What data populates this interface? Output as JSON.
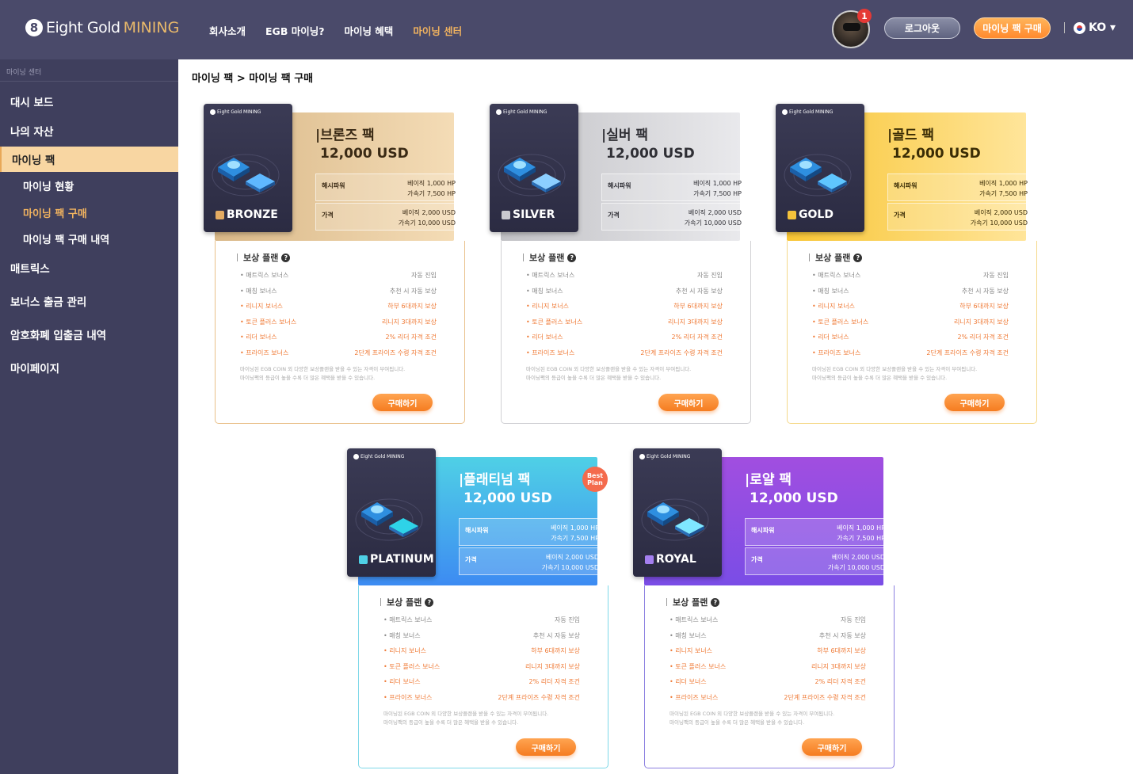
{
  "header": {
    "logo_main": "Eight Gold",
    "logo_accent": "MINING",
    "logo_badge": "8",
    "nav": [
      "회사소개",
      "EGB 마이닝?",
      "마이닝 혜택",
      "마이닝 센터"
    ],
    "notifications": "1",
    "logout_label": "로그아웃",
    "buy_label": "마이닝 팩 구매",
    "lang": "KO ▾"
  },
  "sidebar": {
    "section": "마이닝 센터",
    "items": [
      "대시 보드",
      "나의 자산",
      "마이닝 팩",
      "마이닝 현황",
      "마이닝 팩 구매",
      "마이닝 팩 구매 내역",
      "매트릭스",
      "보너스 출금 관리",
      "암호화폐 입출금 내역",
      "마이페이지"
    ]
  },
  "breadcrumb": "마이닝 팩 > 마이닝 팩 구매",
  "common": {
    "mini_logo": "Eight Gold MINING",
    "price": "12,000 USD",
    "hash_label": "해시파워",
    "hash_base": "베이직  1,000 HP",
    "hash_boost": "가속기  7,500 HP",
    "price_label": "가격",
    "price_base": "베이직  2,000 USD",
    "price_boost": "가속기  10,000 USD",
    "reward_title": "보상 플랜",
    "rewards": [
      {
        "name": "• 매트릭스 보너스",
        "value": "자동 진입"
      },
      {
        "name": "• 매칭 보너스",
        "value": "추천 시 자동 보상"
      },
      {
        "name": "• 리니지 보너스",
        "value": "하부 6대까지 보상"
      },
      {
        "name": "• 토큰 플러스 보너스",
        "value": "리니지 3대까지 보상"
      },
      {
        "name": "• 리더 보너스",
        "value": "2% 리더 자격 조건"
      },
      {
        "name": "• 프라이즈 보너스",
        "value": "2단계 프라이즈 수령 자격 조건"
      }
    ],
    "note1": "마이닝된 EGB COIN 외 다양한 보상플랜을 받을 수 있는 자격이 부여됩니다.",
    "note2": "마이닝팩의 등급이 높을 수록 더 많은 혜택을 받을 수 있습니다.",
    "cta": "구매하기"
  },
  "packs": [
    {
      "title": "|브론즈 팩",
      "tier": "BRONZE",
      "color": "#e0b47a"
    },
    {
      "title": "|실버 팩",
      "tier": "SILVER",
      "color": "#b9b9bd"
    },
    {
      "title": "|골드 팩",
      "tier": "GOLD",
      "color": "#f7c744"
    },
    {
      "title": "|플래티넘 팩",
      "tier": "PLATINUM",
      "color": "#4aa6f0",
      "badge": "Best Plan"
    },
    {
      "title": "|로얄 팩",
      "tier": "ROYAL",
      "color": "#9c4fd6"
    }
  ]
}
